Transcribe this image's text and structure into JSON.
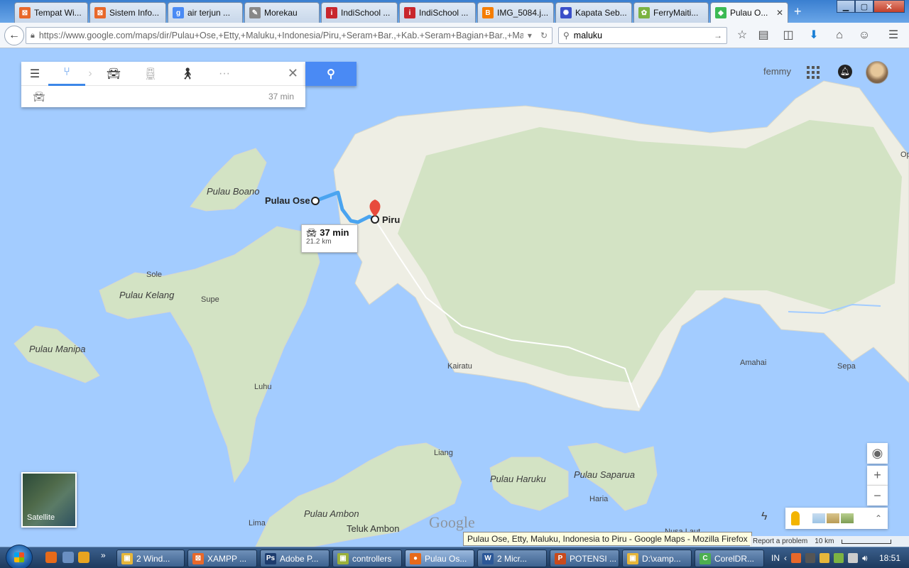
{
  "browser": {
    "tabs": [
      {
        "label": "Tempat Wi...",
        "icon": "xampp-icon",
        "color": "#e8682a"
      },
      {
        "label": "Sistem Info...",
        "icon": "xampp-icon",
        "color": "#e8682a"
      },
      {
        "label": "air terjun ...",
        "icon": "google-icon",
        "color": "#4a8af4"
      },
      {
        "label": "Morekau",
        "icon": "pin-icon",
        "color": "#7a7a7a"
      },
      {
        "label": "IndiSchool ...",
        "icon": "indi-icon",
        "color": "#c8262d"
      },
      {
        "label": "IndiSchool ...",
        "icon": "indi-icon",
        "color": "#c8262d"
      },
      {
        "label": "IMG_5084.j...",
        "icon": "blogger-icon",
        "color": "#f57d00"
      },
      {
        "label": "Kapata Seb...",
        "icon": "gear-icon",
        "color": "#3a4fc9"
      },
      {
        "label": "FerryMaiti...",
        "icon": "leaf-icon",
        "color": "#7cb342"
      },
      {
        "label": "Pulau O...",
        "icon": "maps-icon",
        "color": "#3cba54",
        "active": true
      }
    ],
    "url": "https://www.google.com/maps/dir/Pulau+Ose,+Etty,+Maluku,+Indonesia/Piru,+Seram+Bar.,+Kab.+Seram+Bagian+Bar.,+Malul",
    "url_host": "google.com",
    "search_value": "maluku"
  },
  "directions": {
    "result_duration": "37 min",
    "modes": [
      "menu-icon",
      "directions-icon",
      "car-icon",
      "transit-icon",
      "walk-icon",
      "more-icon"
    ]
  },
  "route_callout": {
    "duration": "37 min",
    "distance": "21.2 km"
  },
  "account": {
    "name": "femmy"
  },
  "map_labels": {
    "pulau_boano": "Pulau Boano",
    "pulau_ose": "Pulau Ose",
    "piru": "Piru",
    "sole": "Sole",
    "pulau_kelang": "Pulau Kelang",
    "supe": "Supe",
    "pulau_manipa": "Pulau Manipa",
    "luhu": "Luhu",
    "kairatu": "Kairatu",
    "amahai": "Amahai",
    "sepa": "Sepa",
    "liang": "Liang",
    "pulau_haruku": "Pulau Haruku",
    "pulau_saparua": "Pulau Saparua",
    "haria": "Haria",
    "pulau_ambon": "Pulau Ambon",
    "lima": "Lima",
    "teluk_ambon": "Teluk Ambon",
    "op": "Op",
    "nusa_laut": "Nusa Laut"
  },
  "map_controls": {
    "satellite_label": "Satellite",
    "zoom_in": "+",
    "zoom_out": "−",
    "report_problem": "Report a problem",
    "scale": "10 km",
    "logo": "Google"
  },
  "tooltip": "Pulau Ose, Etty, Maluku, Indonesia to Piru - Google Maps - Mozilla Firefox",
  "taskbar": {
    "tasks": [
      {
        "label": "2 Wind...",
        "icon": "folder-icon",
        "color": "#e6b63a"
      },
      {
        "label": "XAMPP ...",
        "icon": "xampp-icon",
        "color": "#e8682a"
      },
      {
        "label": "Adobe P...",
        "icon": "photoshop-icon",
        "color": "#1d3c6e"
      },
      {
        "label": "controllers",
        "icon": "folder-icon",
        "color": "#9ab03a"
      },
      {
        "label": "Pulau Os...",
        "icon": "firefox-icon",
        "color": "#e66a1a",
        "active": true
      },
      {
        "label": "2 Micr...",
        "icon": "word-icon",
        "color": "#2b5797"
      },
      {
        "label": "POTENSI ...",
        "icon": "powerpoint-icon",
        "color": "#c94a1c"
      },
      {
        "label": "D:\\xamp...",
        "icon": "folder-icon",
        "color": "#e6b63a"
      },
      {
        "label": "CorelDR...",
        "icon": "corel-icon",
        "color": "#4caf50"
      }
    ],
    "language": "IN",
    "clock": "18:51"
  },
  "colors": {
    "water": "#a3ccff",
    "land": "#eeeee4",
    "forest": "#d3e3c4",
    "route": "#4aa4f0",
    "accent": "#4a8af4",
    "marker": "#e84a3c"
  }
}
